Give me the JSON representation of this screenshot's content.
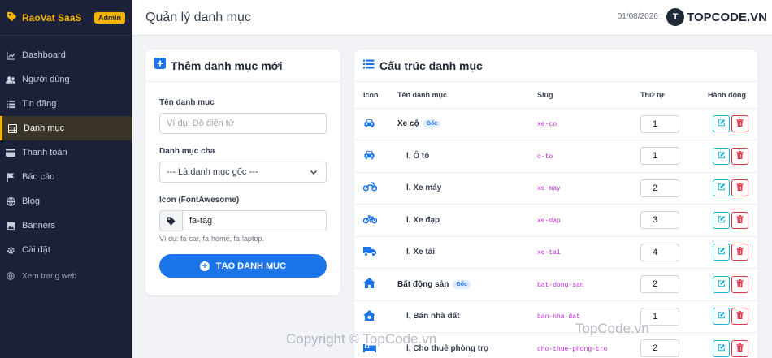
{
  "brand": {
    "name": "RaoVat SaaS",
    "badge": "Admin"
  },
  "sidebar": {
    "items": [
      {
        "label": "Dashboard",
        "icon": "chart-line-icon"
      },
      {
        "label": "Người dùng",
        "icon": "users-icon"
      },
      {
        "label": "Tin đăng",
        "icon": "list-icon"
      },
      {
        "label": "Danh mục",
        "icon": "table-icon",
        "active": true
      },
      {
        "label": "Thanh toán",
        "icon": "credit-card-icon"
      },
      {
        "label": "Báo cáo",
        "icon": "flag-icon"
      },
      {
        "label": "Blog",
        "icon": "globe-icon"
      },
      {
        "label": "Banners",
        "icon": "image-icon"
      },
      {
        "label": "Cài đặt",
        "icon": "gear-icon"
      }
    ],
    "view_site": "Xem trang web"
  },
  "topbar": {
    "title": "Quản lý danh mục",
    "date": "01/08/2026 16:3"
  },
  "watermark": {
    "logo_text": "TOPCODE.VN",
    "bottom": "Copyright © TopCode.vn",
    "right": "TopCode.vn"
  },
  "add_form": {
    "title": "Thêm danh mục mới",
    "name_label": "Tên danh mục",
    "name_placeholder": "Ví dụ: Đồ điện tử",
    "parent_label": "Danh mục cha",
    "parent_value": "--- Là danh mục gốc ---",
    "icon_label": "Icon (FontAwesome)",
    "icon_value": "fa-tag",
    "icon_help": "Ví dụ: fa-car, fa-home, fa-laptop.",
    "submit": "TẠO DANH MỤC"
  },
  "structure": {
    "title": "Cấu trúc danh mục",
    "columns": [
      "Icon",
      "Tên danh mục",
      "Slug",
      "Thứ tự",
      "Hành động"
    ],
    "root_badge": "Gốc",
    "rows": [
      {
        "icon": "car-icon",
        "name": "Xe cộ",
        "root": true,
        "slug": "xe-co",
        "order": "1"
      },
      {
        "icon": "car-icon",
        "name": "l, Ô tô",
        "root": false,
        "slug": "o-to",
        "order": "1"
      },
      {
        "icon": "motorcycle-icon",
        "name": "l, Xe máy",
        "root": false,
        "slug": "xe-may",
        "order": "2"
      },
      {
        "icon": "bicycle-icon",
        "name": "l, Xe đạp",
        "root": false,
        "slug": "xe-dap",
        "order": "3"
      },
      {
        "icon": "truck-icon",
        "name": "l, Xe tải",
        "root": false,
        "slug": "xe-tai",
        "order": "4"
      },
      {
        "icon": "home-icon",
        "name": "Bất động sản",
        "root": true,
        "slug": "bat-dong-san",
        "order": "2"
      },
      {
        "icon": "house-dollar-icon",
        "name": "l, Bán nhà đất",
        "root": false,
        "slug": "ban-nha-dat",
        "order": "1"
      },
      {
        "icon": "bed-icon",
        "name": "l, Cho thuê phòng trọ",
        "root": false,
        "slug": "cho-thue-phong-tro",
        "order": "2"
      }
    ]
  }
}
